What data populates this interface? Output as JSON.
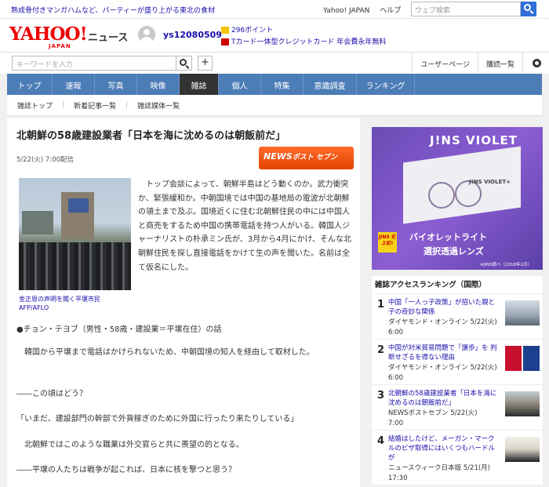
{
  "topbar": {
    "headline": "熟成骨付きマンガハムなど、パーティーが盛り上がる東北の食材",
    "links": [
      "Yahoo! JAPAN",
      "ヘルプ"
    ],
    "search_placeholder": "ウェブ検索"
  },
  "header": {
    "logo": "YAHOO!",
    "logo_sub": "JAPAN",
    "service": "ニュース",
    "username": "ys12080509",
    "points": "296ポイント",
    "tcard": "Tカード一体型クレジットカード 年会費永年無料"
  },
  "searchrow": {
    "keyword_placeholder": "キーワードを入力",
    "plus": "+",
    "user_page": "ユーザーページ",
    "purchase": "購読一覧"
  },
  "nav": {
    "items": [
      "トップ",
      "速報",
      "写真",
      "映像",
      "雑誌",
      "個人",
      "特集",
      "意識調査",
      "ランキング"
    ],
    "active": "雑誌"
  },
  "subnav": {
    "items": [
      "雑誌トップ",
      "新着記事一覧",
      "雑誌媒体一覧"
    ]
  },
  "article": {
    "title": "北朝鮮の58歳建設業者「日本を海に沈めるのは朝飯前だ」",
    "date": "5/22(火) 7:00配信",
    "brand": "NEWSポストセブン",
    "brand_main": "NEWS",
    "brand_sub": "ポスト セブン",
    "caption": "金正恩の声明を聞く平壌市民　AFP/AFLO",
    "lead": "トップ会談によって、朝鮮半島はどう動くのか。武力衝突か、緊張緩和か。中朝国境では中国の基地局の電波が北朝鮮の領土まで及ぶ。国境近くに住む北朝鮮住民の中には中国人と商売をするため中国の携帯電話を持つ人がいる。韓国人ジャーナリストの朴承ミン氏が、3月から4月にかけ、そんな北朝鮮住民を探し直接電話をかけて生の声を聞いた。名前は全て仮名にした。",
    "p1": "●チョン・テヨブ（男性・58歳・建設業＝平壌在住）の話",
    "p2": "　韓国から平壌まで電話はかけられないため、中朝国境の知人を経由して取材した。",
    "p3": "――この頃はどう？",
    "p4": "「いまだ、建設部門の幹部で外貨稼ぎのために外国に行ったり来たりしている」",
    "p5": "　北朝鮮ではこのような職業は外交官らと共に羨望の的となる。",
    "p6": "――平壌の人たちは戦争が起これば、日本に核を撃つと思う？"
  },
  "ad": {
    "title": "J!NS VIOLET",
    "box_label": "J!NS VIOLET+",
    "badge": "JINS 史上初!",
    "line1": "バイオレットライト",
    "line2": "選択透過レンズ",
    "note": "※JINS調べ（2018年2月）"
  },
  "ranking": {
    "heading": "雑誌アクセスランキング（国際）",
    "items": [
      {
        "num": "1",
        "title": "中国「一人っ子政策」が招いた親と子の奇妙な関係",
        "source": "ダイヤモンド・オンライン 5/22(火)",
        "time": "6:00"
      },
      {
        "num": "2",
        "title": "中国が対米貿易問題で「譲歩」を 判断せざるを得ない理由",
        "source": "ダイヤモンド・オンライン 5/22(火)",
        "time": "6:00"
      },
      {
        "num": "3",
        "title": "北朝鮮の58歳建設業者「日本を海に沈めるのは朝飯前だ」",
        "source": "NEWSポストセブン 5/22(火)",
        "time": "7:00"
      },
      {
        "num": "4",
        "title": "結婚はしたけど、メーガン・マークルのビザ取得にはいくつもハードルが",
        "source": "ニュースウィーク日本版 5/21(月)",
        "time": "17:30"
      }
    ]
  },
  "colors": {
    "nav_blue": "#4d7db7",
    "link_blue": "#1a0dab",
    "logo_red": "#ee0000",
    "brand_orange": "#ff6a2b"
  }
}
